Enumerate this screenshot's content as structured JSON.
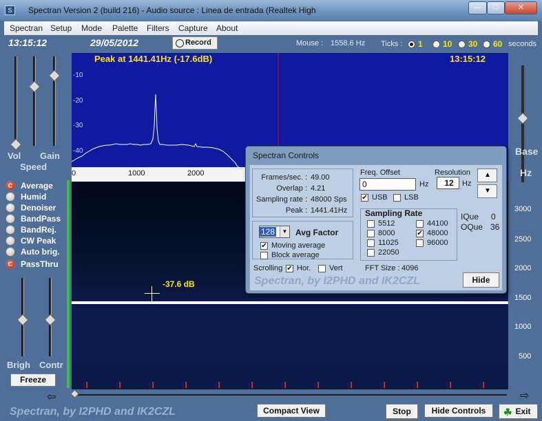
{
  "window": {
    "title": "Spectran Version 2 (build 216) - Audio source : Linea de entrada (Realtek High",
    "icon_label": "S"
  },
  "menu": [
    "Spectran",
    "Setup",
    "Mode",
    "Palette",
    "Filters",
    "Capture",
    "About"
  ],
  "header": {
    "time": "13:15:12",
    "date": "29/05/2012",
    "record_label": "Record",
    "mouse_label": "Mouse :",
    "mouse_value": "1558.6 Hz",
    "ticks_label": "Ticks :",
    "ticks_options": [
      "1",
      "10",
      "30",
      "60"
    ],
    "ticks_selected": "1",
    "ticks_unit": "seconds"
  },
  "spectrum": {
    "peak_text": "Peak at  1441.41Hz (-17.6dB)",
    "time_right": "13:15:12",
    "y_ticks": [
      "-10",
      "-20",
      "-30",
      "-40"
    ],
    "x_ticks": [
      "0",
      "1000",
      "2000"
    ]
  },
  "left_sliders": {
    "labels": [
      "Vol",
      "Gain"
    ],
    "speed_label": "Speed",
    "bottom_labels": [
      "Brigh",
      "Contr"
    ]
  },
  "functions": [
    {
      "label": "Average",
      "on": true
    },
    {
      "label": "Humid",
      "on": false
    },
    {
      "label": "Denoiser",
      "on": false
    },
    {
      "label": "BandPass",
      "on": false
    },
    {
      "label": "BandRej.",
      "on": false
    },
    {
      "label": "CW Peak",
      "on": false
    },
    {
      "label": "Auto brig.",
      "on": false
    },
    {
      "label": "PassThru",
      "on": true
    }
  ],
  "func_on_glyph": "C",
  "waterfall": {
    "cursor_level": "-37.6 dB",
    "right_scale": [
      "3000",
      "2500",
      "2000",
      "1500",
      "1000",
      "500"
    ],
    "right_labels": [
      "Base",
      "Hz"
    ]
  },
  "buttons": {
    "freeze": "Freeze",
    "compact_view": "Compact View",
    "stop": "Stop",
    "hide_controls": "Hide Controls",
    "exit": "Exit"
  },
  "footer_watermark": "Spectran, by I2PHD and IK2CZL",
  "dialog": {
    "title": "Spectran Controls",
    "stats": [
      {
        "label": "Frames/sec. :",
        "value": "49.00"
      },
      {
        "label": "Overlap :",
        "value": "4.21"
      },
      {
        "label": "Sampling rate :",
        "value": "48000 Sps"
      },
      {
        "label": "Peak :",
        "value": "1441.41Hz"
      }
    ],
    "freq_offset_label": "Freq. Offset",
    "freq_offset_value": "0",
    "hz1": "Hz",
    "resolution_label": "Resolution",
    "resolution_value": "12",
    "hz2": "Hz",
    "usb_label": "USB",
    "lsb_label": "LSB",
    "usb_checked": true,
    "lsb_checked": false,
    "avg_value": "128",
    "avg_label": "Avg Factor",
    "moving_average_label": "Moving average",
    "block_average_label": "Block average",
    "moving_checked": true,
    "block_checked": false,
    "sampling_rate_title": "Sampling Rate",
    "rates_left": [
      "5512",
      "8000",
      "11025",
      "22050"
    ],
    "rates_right": [
      "44100",
      "48000",
      "96000"
    ],
    "rate_selected": "48000",
    "iq_label": "IQue",
    "iq_value": "0",
    "oq_label": "OQue",
    "oq_value": "36",
    "scrolling_label": "Scrolling",
    "hor_label": "Hor.",
    "vert_label": "Vert",
    "hor_checked": true,
    "vert_checked": false,
    "fft_size_label": "FFT Size :",
    "fft_size_value": "4096",
    "watermark": "Spectran, by I2PHD and IK2CZL",
    "hide_label": "Hide"
  },
  "colors": {
    "spectrum_bg": "#0f1aa0",
    "trace": "#ffffff",
    "cursor_line": "#cc1111",
    "accent_yellow": "#ffe600",
    "active_red": "#c81c04"
  }
}
